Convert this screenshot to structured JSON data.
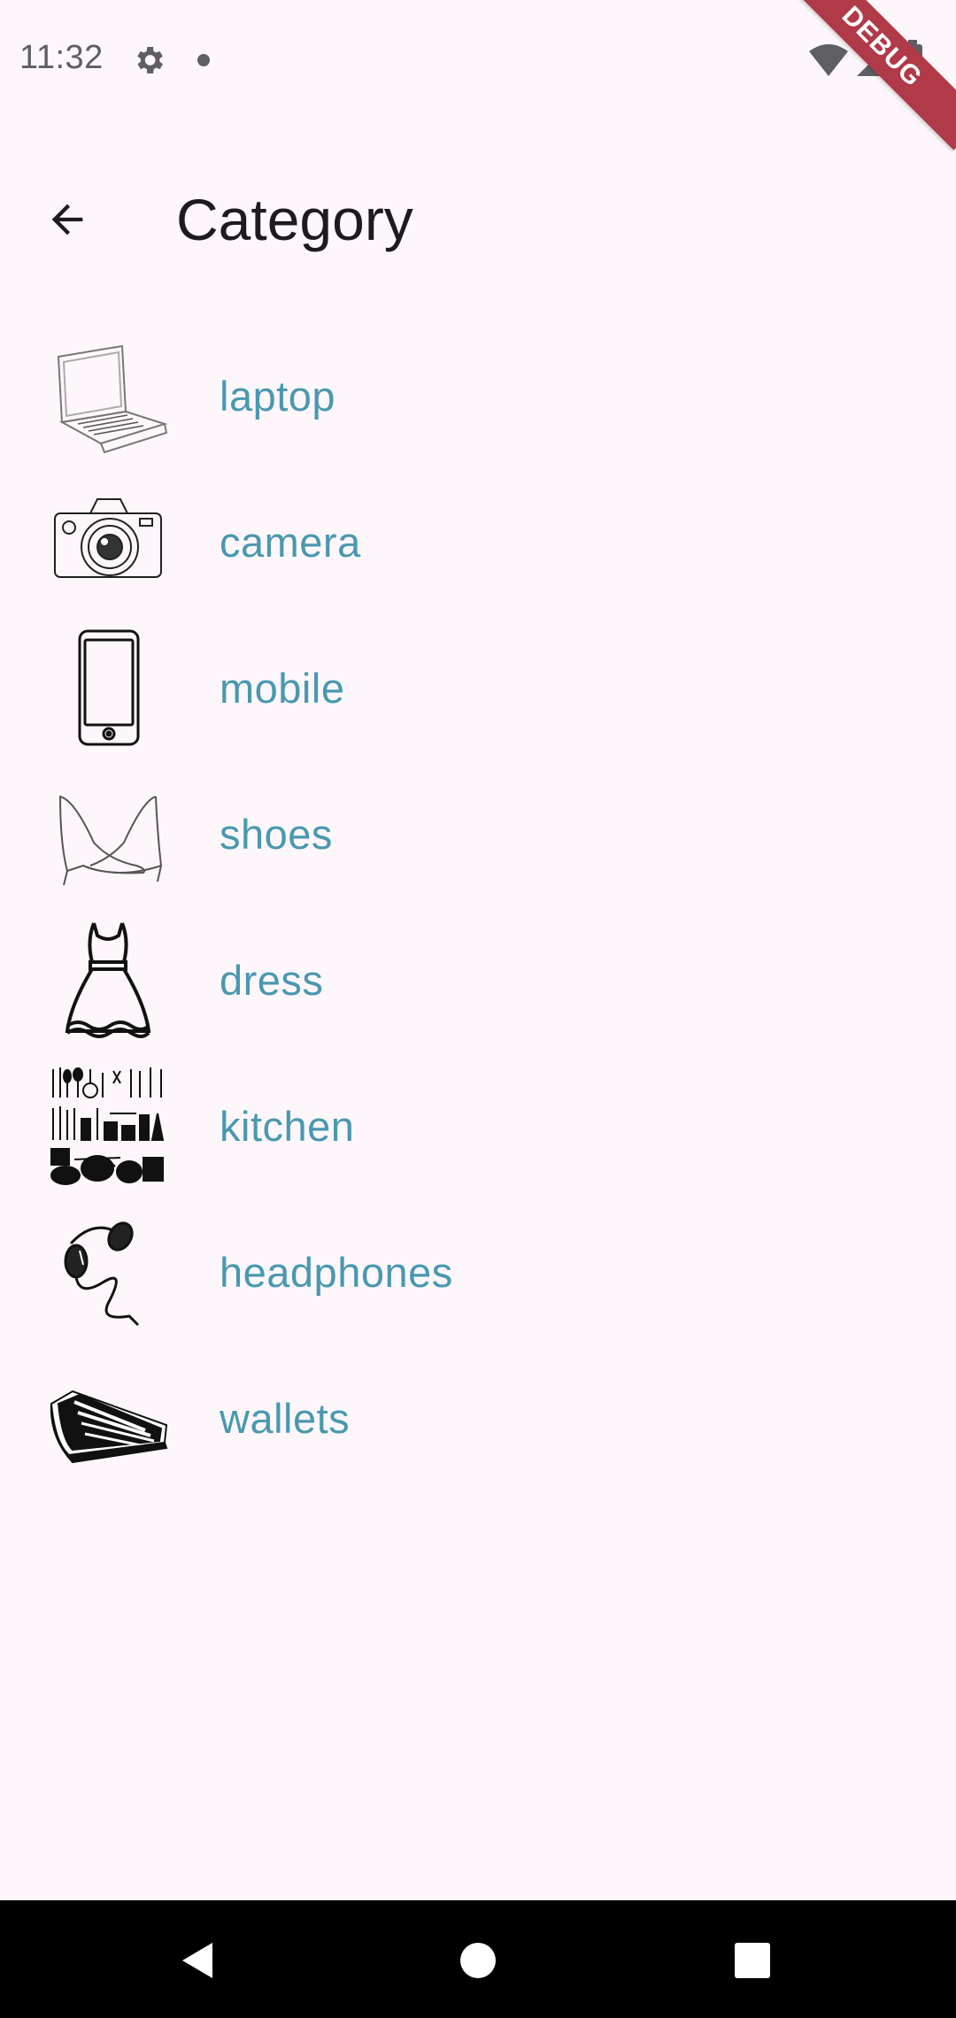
{
  "status_bar": {
    "time": "11:32",
    "icons": [
      "gear-icon",
      "notification-dot-icon",
      "wifi-icon",
      "signal-icon",
      "battery-icon"
    ]
  },
  "debug_banner": "DEBUG",
  "app_bar": {
    "title": "Category",
    "back_icon": "arrow-back-icon"
  },
  "categories": [
    {
      "label": "laptop",
      "icon": "laptop-icon"
    },
    {
      "label": "camera",
      "icon": "camera-icon"
    },
    {
      "label": "mobile",
      "icon": "mobile-icon"
    },
    {
      "label": "shoes",
      "icon": "shoes-icon"
    },
    {
      "label": "dress",
      "icon": "dress-icon"
    },
    {
      "label": "kitchen",
      "icon": "kitchen-icon"
    },
    {
      "label": "headphones",
      "icon": "headphones-icon"
    },
    {
      "label": "wallets",
      "icon": "wallets-icon"
    }
  ],
  "nav_bar": {
    "buttons": [
      "back-triangle-icon",
      "home-circle-icon",
      "recents-square-icon"
    ]
  },
  "colors": {
    "background": "#fdf7fb",
    "label": "#4a98b0",
    "title": "#1d1b20",
    "debug": "#b03a48",
    "nav": "#000000"
  }
}
